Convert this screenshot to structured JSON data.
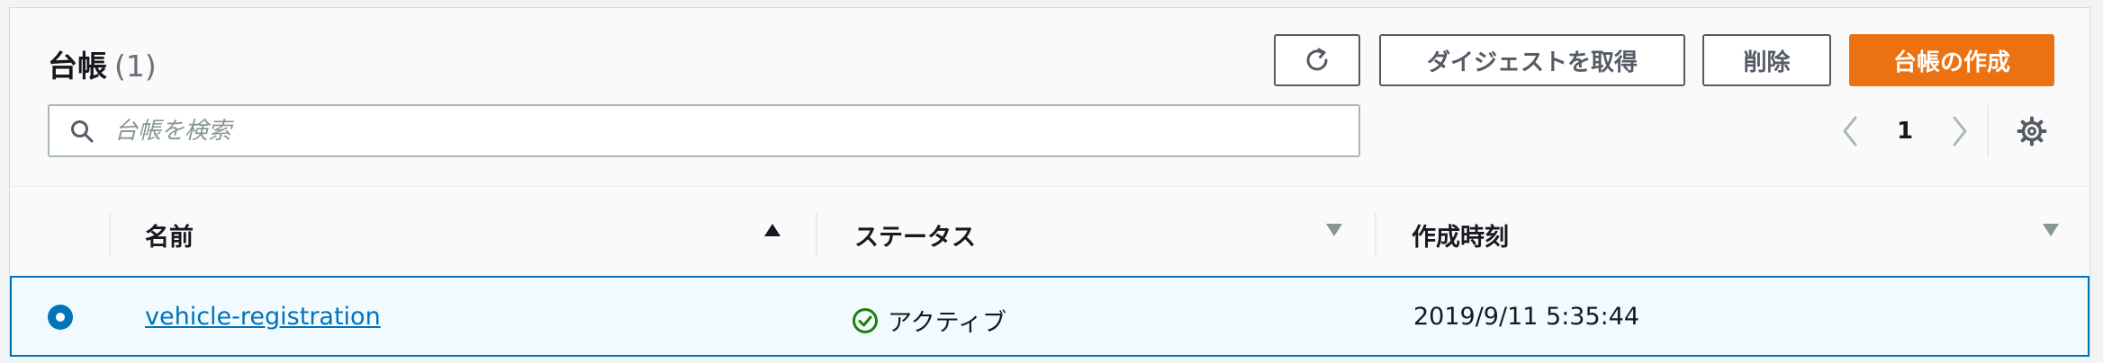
{
  "header": {
    "title": "台帳",
    "count": "(1)"
  },
  "toolbar": {
    "refresh_icon": "refresh-icon",
    "digest_label": "ダイジェストを取得",
    "delete_label": "削除",
    "create_label": "台帳の作成"
  },
  "search": {
    "placeholder": "台帳を検索",
    "value": ""
  },
  "pagination": {
    "current_page": "1"
  },
  "table": {
    "columns": [
      {
        "label": "名前",
        "sort": "ascending"
      },
      {
        "label": "ステータス",
        "sort": "none"
      },
      {
        "label": "作成時刻",
        "sort": "none"
      }
    ],
    "rows": [
      {
        "selected": true,
        "name": "vehicle-registration",
        "status": "アクティブ",
        "created": "2019/9/11 5:35:44"
      }
    ]
  },
  "colors": {
    "primary": "#ec7211",
    "link": "#0073bb",
    "success": "#1d8102",
    "selected_row_bg": "#f1faff"
  }
}
